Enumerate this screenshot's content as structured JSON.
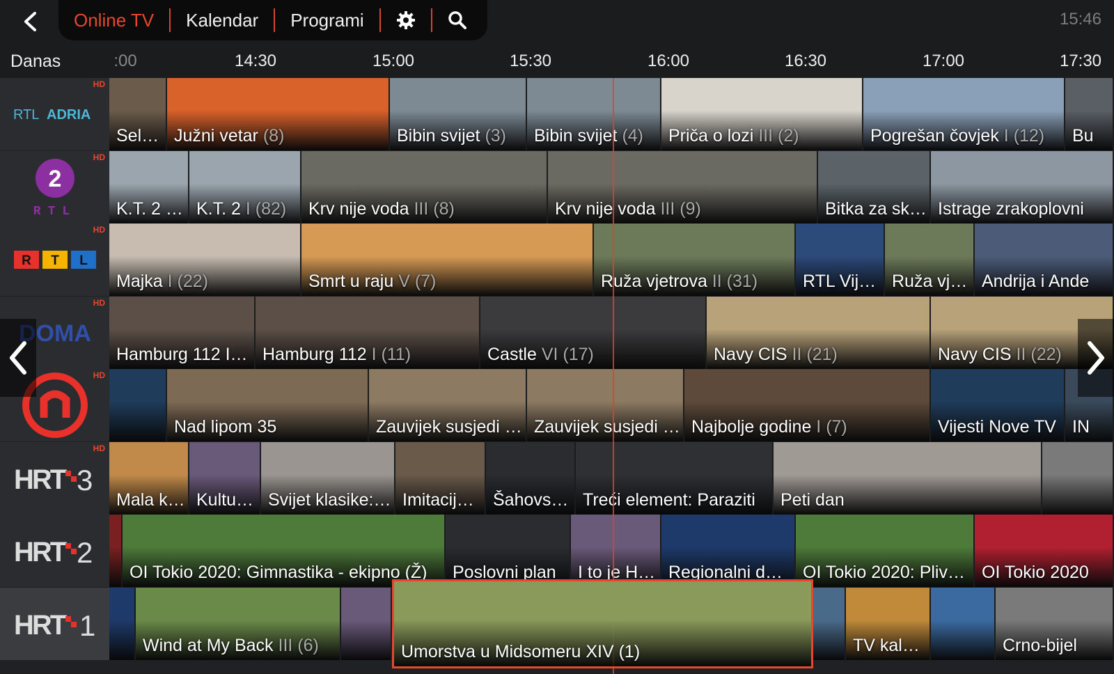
{
  "header": {
    "tabs": [
      {
        "label": "Online TV",
        "active": true
      },
      {
        "label": "Kalendar"
      },
      {
        "label": "Programi"
      }
    ],
    "clock": "15:46"
  },
  "timeline": {
    "day": "Danas",
    "ticks": [
      ":00",
      "14:30",
      "15:00",
      "15:30",
      "16:00",
      "16:30",
      "17:00",
      "17:30"
    ]
  },
  "channels": [
    {
      "name": "RTL ADRIA",
      "hd": "HD",
      "programs": [
        {
          "title": "Sel…",
          "color": "#6b5b4a"
        },
        {
          "title": "Južni vetar",
          "ep": " (8)",
          "color": "#d9612a"
        },
        {
          "title": "Bibin svijet",
          "ep": " (3)",
          "color": "#7d8a94"
        },
        {
          "title": "Bibin svijet",
          "ep": " (4)",
          "color": "#7d8a94"
        },
        {
          "title": "Priča o lozi",
          "ep": " III (2)",
          "color": "#d8d4cc"
        },
        {
          "title": "Pogrešan čovjek",
          "ep": " I (12)",
          "color": "#8aa0b8"
        },
        {
          "title": "Bu",
          "color": "#5a5f66"
        }
      ]
    },
    {
      "name": "2 RTL",
      "hd": "HD",
      "programs": [
        {
          "title": "K.T. 2 I…",
          "color": "#9aa5ad"
        },
        {
          "title": "K.T. 2",
          "ep": " I (82)",
          "color": "#9aa5ad"
        },
        {
          "title": "Krv nije voda",
          "ep": " III (8)",
          "color": "#6b6a62"
        },
        {
          "title": "Krv nije voda",
          "ep": " III (9)",
          "color": "#6b6a62"
        },
        {
          "title": "Bitka za sk…",
          "color": "#5b6368"
        },
        {
          "title": "Istrage zrakoplovni",
          "color": "#8c97a1"
        }
      ]
    },
    {
      "name": "RTL",
      "hd": "HD",
      "programs": [
        {
          "title": "Majka",
          "ep": " I (22)",
          "color": "#c8bcb1"
        },
        {
          "title": "Smrt u raju",
          "ep": " V (7)",
          "color": "#d79a54"
        },
        {
          "title": "Ruža vjetrova",
          "ep": " II (31)",
          "color": "#6d7a5a"
        },
        {
          "title": "RTL Vijesti",
          "color": "#2c4a7a"
        },
        {
          "title": "Ruža vje…",
          "color": "#6d7a5a"
        },
        {
          "title": "Andrija i Ande",
          "color": "#4c5c78"
        }
      ]
    },
    {
      "name": "DOMA",
      "hd": "HD",
      "programs": [
        {
          "title": "Hamburg 112 I…",
          "color": "#5c4f48"
        },
        {
          "title": "Hamburg 112",
          "ep": " I (11)",
          "color": "#5c4f48"
        },
        {
          "title": "Castle",
          "ep": " VI (17)",
          "color": "#3b3a3c"
        },
        {
          "title": "Navy CIS",
          "ep": " II (21)",
          "color": "#b8a27a"
        },
        {
          "title": "Navy CIS",
          "ep": " II (22)",
          "color": "#b8a27a"
        }
      ]
    },
    {
      "name": "NOVA",
      "hd": "HD",
      "programs": [
        {
          "title": "",
          "color": "#1f3c5a"
        },
        {
          "title": "Nad lipom 35",
          "color": "#7d6a55"
        },
        {
          "title": "Zauvijek susjedi …",
          "color": "#8c7a62"
        },
        {
          "title": "Zauvijek susjedi …",
          "color": "#8c7a62"
        },
        {
          "title": "Najbolje godine",
          "ep": " I (7)",
          "color": "#5d4a3a"
        },
        {
          "title": "Vijesti Nove TV",
          "color": "#1f3c5a"
        },
        {
          "title": "IN",
          "color": "#3a4a5a"
        }
      ]
    },
    {
      "name": "HRT 3",
      "hd": "HD",
      "programs": [
        {
          "title": "Mala k…",
          "color": "#c28a4a"
        },
        {
          "title": "Kultu…",
          "color": "#6a5a7a"
        },
        {
          "title": "Svijet klasike:…",
          "color": "#9a9590"
        },
        {
          "title": "Imitacij…",
          "color": "#6a5a4a"
        },
        {
          "title": "Šahovs…",
          "color": "#2a2c30"
        },
        {
          "title": "Treći element: Paraziti",
          "color": "#2e3034"
        },
        {
          "title": "Peti dan",
          "color": "#a09a95"
        },
        {
          "title": "",
          "color": "#7a7a7a"
        }
      ]
    },
    {
      "name": "HRT 2",
      "hd": "",
      "programs": [
        {
          "title": "",
          "color": "#7a2020"
        },
        {
          "title": "OI Tokio 2020: Gimnastika - ekipno (Ž)",
          "color": "#4e7a3a"
        },
        {
          "title": "Poslovni plan",
          "color": "#2a2c30"
        },
        {
          "title": "I to je H…",
          "color": "#6a5a7a"
        },
        {
          "title": "Regionalni dn…",
          "color": "#1e3a6a"
        },
        {
          "title": "OI Tokio 2020: Pliva…",
          "color": "#4e7a3a"
        },
        {
          "title": "OI Tokio 2020",
          "color": "#b02030"
        }
      ]
    },
    {
      "name": "HRT 1",
      "hd": "",
      "programs": [
        {
          "title": "",
          "color": "#1e3a6a"
        },
        {
          "title": "Wind at My Back",
          "ep": " III (6)",
          "color": "#6a8a4a"
        },
        {
          "title": "",
          "color": "#6a5a7a"
        },
        {
          "title": "Umorstva u Midsomeru XIV (1)",
          "color": "#8a9a5a",
          "selected": true
        },
        {
          "title": "",
          "color": "#4a6a8a"
        },
        {
          "title": "TV kal…",
          "color": "#c08a3a"
        },
        {
          "title": "",
          "color": "#3a6aa0"
        },
        {
          "title": "Crno-bijel",
          "color": "#7a7a7a"
        }
      ]
    }
  ]
}
